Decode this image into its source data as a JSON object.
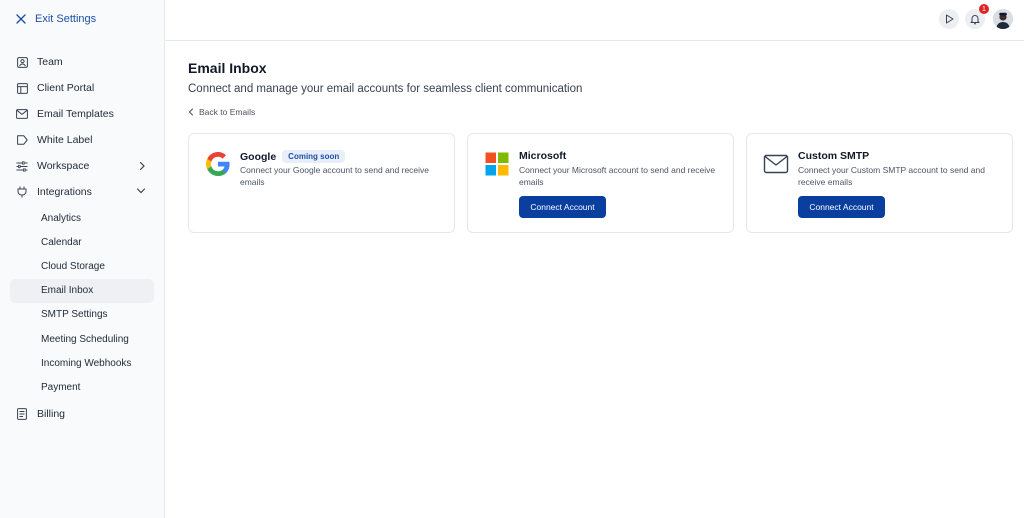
{
  "sidebar": {
    "exit_label": "Exit Settings",
    "items": [
      {
        "label": "Team",
        "icon": "user-square-icon"
      },
      {
        "label": "Client Portal",
        "icon": "layout-icon"
      },
      {
        "label": "Email Templates",
        "icon": "mail-icon"
      },
      {
        "label": "White Label",
        "icon": "tag-icon"
      },
      {
        "label": "Workspace",
        "icon": "sliders-icon"
      },
      {
        "label": "Integrations",
        "icon": "plug-icon"
      }
    ],
    "integrations_sub": [
      "Analytics",
      "Calendar",
      "Cloud Storage",
      "Email Inbox",
      "SMTP Settings",
      "Meeting Scheduling",
      "Incoming Webhooks",
      "Payment"
    ],
    "active_sub": "Email Inbox",
    "billing_label": "Billing"
  },
  "topbar": {
    "notification_count": "1"
  },
  "main": {
    "title": "Email Inbox",
    "subtitle": "Connect and manage your email accounts for seamless client communication",
    "back_label": "Back to Emails",
    "cards": [
      {
        "name": "Google",
        "badge": "Coming soon",
        "desc": "Connect your Google account to send and receive emails"
      },
      {
        "name": "Microsoft",
        "desc": "Connect your Microsoft account to send and receive emails",
        "button": "Connect Account"
      },
      {
        "name": "Custom SMTP",
        "desc": "Connect your Custom SMTP account to send and receive emails",
        "button": "Connect Account"
      }
    ]
  },
  "colors": {
    "primary": "#0a3fa0",
    "accent_text": "#1f4fa8",
    "badge_bg": "#e8effb",
    "notification": "#dc2626"
  }
}
